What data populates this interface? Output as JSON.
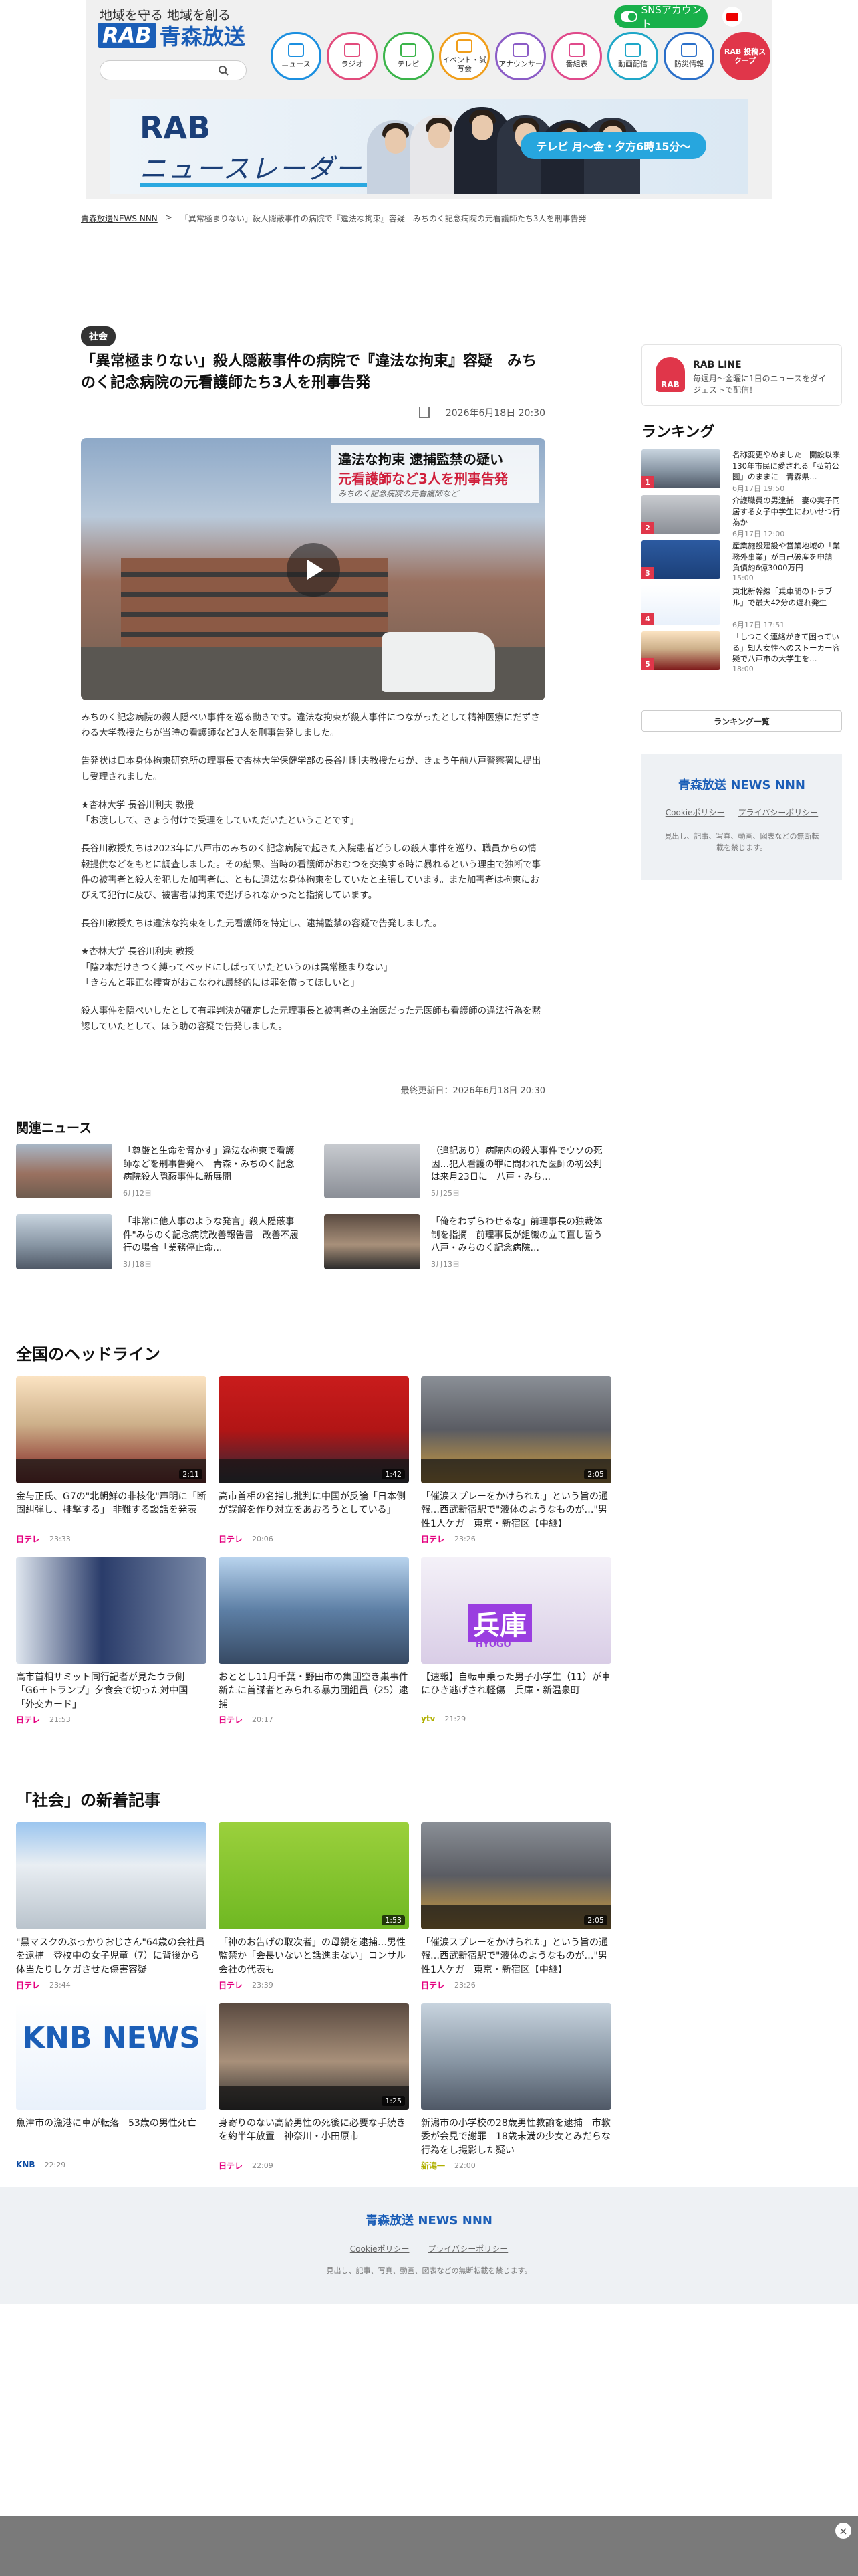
{
  "header": {
    "tagline": "地域を守る 地域を創る",
    "logo_rab": "RAB",
    "logo_name": "青森放送",
    "sns_label": "SNSアカウント",
    "nav": [
      {
        "label": "ニュース"
      },
      {
        "label": "ラジオ"
      },
      {
        "label": "テレビ"
      },
      {
        "label": "イベント・試写会"
      },
      {
        "label": "アナウンサー"
      },
      {
        "label": "番組表"
      },
      {
        "label": "動画配信"
      },
      {
        "label": "防災情報"
      },
      {
        "label": "RAB 投稿スクープ"
      }
    ],
    "banner": {
      "logo_line1": "RAB",
      "logo_line2": "ニュースレーダー",
      "schedule": "テレビ 月～金・夕方6時15分～"
    }
  },
  "breadcrumb": {
    "home": "青森放送NEWS NNN",
    "current": "「異常極まりない」殺人隠蔽事件の病院で『違法な拘束』容疑　みちのく記念病院の元看護師たち3人を刑事告発"
  },
  "article": {
    "category": "社会",
    "title": "「異常極まりない」殺人隠蔽事件の病院で『違法な拘束』容疑　みちのく記念病院の元看護師たち3人を刑事告発",
    "date": "2026年6月18日 20:30",
    "hero_caption": {
      "line1": "違法な拘束 逮捕監禁の疑い",
      "line2": "元看護師など3人を刑事告発",
      "line3": "みちのく記念病院の元看護師など"
    },
    "paragraphs": [
      "みちのく記念病院の殺人隠ぺい事件を巡る動きです。違法な拘束が殺人事件につながったとして精神医療にだずさわる大学教授たちが当時の看護師など3人を刑事告発しました。",
      "告発状は日本身体拘束研究所の理事長で杏林大学保健学部の長谷川利夫教授たちが、きょう午前八戸警察署に提出し受理されました。",
      "★杏林大学 長谷川利夫 教授\n「お渡しして、きょう付けで受理をしていただいたということです」",
      "長谷川教授たちは2023年に八戸市のみちのく記念病院で起きた入院患者どうしの殺人事件を巡り、職員からの情報提供などをもとに調査しました。その結果、当時の看護師がおむつを交換する時に暴れるという理由で独断で事件の被害者と殺人を犯した加害者に、ともに違法な身体拘束をしていたと主張しています。また加害者は拘束におびえて犯行に及び、被害者は拘束で逃げられなかったと指摘しています。",
      "長谷川教授たちは違法な拘束をした元看護師を特定し、逮捕監禁の容疑で告発しました。",
      "★杏林大学 長谷川利夫 教授\n「陰2本だけきつく縛ってベッドにしばっていたというのは異常極まりない」\n「きちんと罪正な捜査がおこなわれ最終的には罪を償ってほしいと」",
      "殺人事件を隠ぺいしたとして有罪判決が確定した元理事長と被害者の主治医だった元医師も看護師の違法行為を黙認していたとして、ほう助の容疑で告発しました。"
    ],
    "updated": "最終更新日：2026年6月18日 20:30"
  },
  "sidebar": {
    "line": {
      "logo": "RAB",
      "title": "RAB LINE",
      "desc": "毎週月～金曜に1日のニュースをダイジェストで配信！"
    },
    "ranking_title": "ランキング",
    "ranking": [
      {
        "num": "1",
        "title": "名称変更やめました　開設以来130年市民に愛される「弘前公園」のままに　青森県…",
        "date": "6月17日 19:50"
      },
      {
        "num": "2",
        "title": "介護職員の男逮捕　妻の実子同居する女子中学生にわいせつ行為か",
        "date": "6月17日 12:00"
      },
      {
        "num": "3",
        "title": "産業施設建設や営業地域の「業務外事業」が自己破産を申請　負債約6億3000万円",
        "date": "15:00"
      },
      {
        "num": "4",
        "title": "東北新幹線「乗車間のトラブル」で最大42分の遅れ発生",
        "date": "6月17日 17:51"
      },
      {
        "num": "5",
        "title": "「しつこく連絡がきて困っている」知人女性へのストーカー容疑で八戸市の大学生を…",
        "date": "18:00"
      }
    ],
    "ranking_button": "ランキング一覧",
    "foot": {
      "logo": "青森放送 NEWS NNN",
      "links": [
        "Cookieポリシー",
        "プライバシーポリシー"
      ],
      "note": "見出し、記事、写真、動画、図表などの無断転載を禁じます。"
    }
  },
  "related": {
    "title": "関連ニュース",
    "items": [
      {
        "title": "「尊厳と生命を脅かす」違法な拘束で看護師などを刑事告発へ　青森・みちのく記念病院殺人隠蔽事件に新展開",
        "date": "6月12日"
      },
      {
        "title": "（追記あり）病院内の殺人事件でウソの死因…犯人看護の罪に問われた医師の初公判は来月23日に　八戸・みち…",
        "date": "5月25日"
      },
      {
        "title": "「非常に他人事のような発言」殺人隠蔽事件\"みちのく記念病院改善報告書　改善不履行の場合「業務停止命…",
        "date": "3月18日"
      },
      {
        "title": "「俺をわずらわせるな」前理事長の独裁体制を指摘　前理事長が組織の立て直し誓う　八戸・みちのく記念病院…",
        "date": "3月13日"
      }
    ]
  },
  "national": {
    "title": "全国のヘッドライン",
    "items": [
      {
        "title": "金与正氏、G7の\"北朝鮮の非核化\"声明に「断固糾弾し、排撃する」 非難する談話を発表",
        "source": "日テレ",
        "time": "23:33",
        "dur": "2:11"
      },
      {
        "title": "高市首相の名指し批判に中国が反論「日本側が誤解を作り対立をあおろうとしている」",
        "source": "日テレ",
        "time": "20:06",
        "dur": "1:42"
      },
      {
        "title": "「催涙スプレーをかけられた」という旨の通報…西武新宿駅で\"液体のようなものが…\"男性1人ケガ　東京・新宿区【中継】",
        "source": "日テレ",
        "time": "23:26",
        "dur": "2:05"
      },
      {
        "title": "高市首相サミット同行記者が見たウラ側「G6＋トランプ」夕食会で切った対中国「外交カード」",
        "source": "日テレ",
        "time": "21:53",
        "dur": ""
      },
      {
        "title": "おととし11月千葉・野田市の集団空き巣事件　新たに首謀者とみられる暴力団組員（25）逮捕",
        "source": "日テレ",
        "time": "20:17",
        "dur": ""
      },
      {
        "title": "【速報】自転車乗った男子小学生（11）が車にひき逃げされ軽傷　兵庫・新温泉町",
        "source": "ytv",
        "time": "21:29",
        "dur": "",
        "place": "兵庫",
        "place_en": "HYOGO"
      }
    ]
  },
  "society": {
    "title": "「社会」の新着記事",
    "items": [
      {
        "title": "\"黒マスクのぶっかりおじさん\"64歳の会社員を逮捕　登校中の女子児童（7）に背後から体当たりしケガさせた傷害容疑",
        "source": "日テレ",
        "time": "23:44",
        "dur": ""
      },
      {
        "title": "「神のお告げの取次者」の母親を逮捕…男性監禁か「会長いないと話進まない」コンサル会社の代表も",
        "source": "日テレ",
        "time": "23:39",
        "dur": "1:53"
      },
      {
        "title": "「催涙スプレーをかけられた」という旨の通報…西武新宿駅で\"液体のようなものが…\"男性1人ケガ　東京・新宿区【中継】",
        "source": "日テレ",
        "time": "23:26",
        "dur": "2:05"
      },
      {
        "title": "魚津市の漁港に車が転落　53歳の男性死亡",
        "source": "KNB",
        "time": "22:29",
        "dur": "",
        "logo": "KNB NEWS"
      },
      {
        "title": "身寄りのない高齢男性の死後に必要な手続きを約半年放置　神奈川・小田原市",
        "source": "日テレ",
        "time": "22:09",
        "dur": "1:25"
      },
      {
        "title": "新潟市の小学校の28歳男性教諭を逮捕　市教委が会見で謝罪　18歳未満の少女とみだらな行為をし撮影した疑い",
        "source": "新潟一",
        "time": "22:00",
        "dur": ""
      }
    ]
  },
  "footer": {
    "logo": "青森放送 NEWS NNN",
    "links": [
      "Cookieポリシー",
      "プライバシーポリシー"
    ],
    "note": "見出し、記事、写真、動画、図表などの無断転載を禁じます。"
  },
  "ad": {
    "close": "×"
  }
}
